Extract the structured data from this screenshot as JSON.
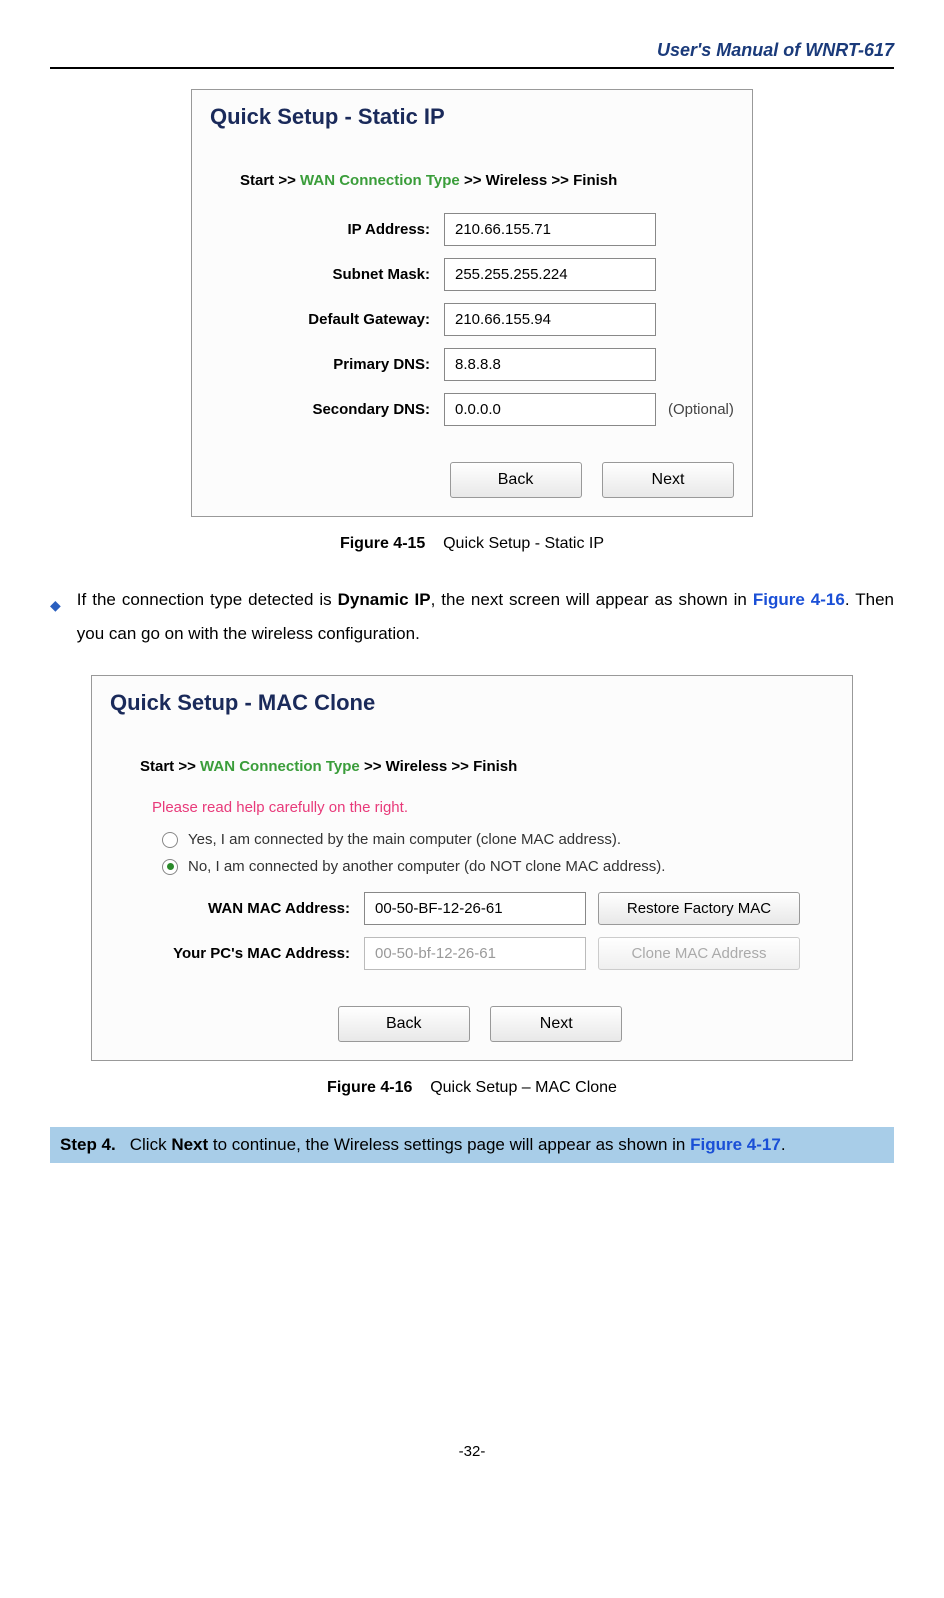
{
  "header": {
    "title": "User's Manual of WNRT-617"
  },
  "figure1": {
    "panelTitle": "Quick Setup - Static IP",
    "breadcrumb": {
      "start": "Start >>",
      "active": "WAN Connection Type",
      "sep1": ">>",
      "wireless": "Wireless",
      "sep2": ">>",
      "finish": "Finish"
    },
    "rows": {
      "ip": {
        "label": "IP Address:",
        "value": "210.66.155.71"
      },
      "subnet": {
        "label": "Subnet Mask:",
        "value": "255.255.255.224"
      },
      "gateway": {
        "label": "Default Gateway:",
        "value": "210.66.155.94"
      },
      "pdns": {
        "label": "Primary DNS:",
        "value": "8.8.8.8"
      },
      "sdns": {
        "label": "Secondary DNS:",
        "value": "0.0.0.0",
        "optional": "(Optional)"
      }
    },
    "buttons": {
      "back": "Back",
      "next": "Next"
    },
    "caption": {
      "label": "Figure 4-15",
      "text": "Quick Setup - Static IP"
    }
  },
  "bulletText": {
    "t1": "If the connection type detected is ",
    "bold1": "Dynamic IP",
    "t2": ", the next screen will appear as shown in ",
    "link1": "Figure 4-16",
    "t3": ". Then you can go on with the wireless configuration."
  },
  "figure2": {
    "panelTitle": "Quick Setup - MAC Clone",
    "breadcrumb": {
      "start": "Start >>",
      "active": "WAN Connection Type",
      "sep1": ">>",
      "wireless": "Wireless",
      "sep2": ">>",
      "finish": "Finish"
    },
    "warning": "Please read help carefully on the right.",
    "radio1": "Yes, I am connected by the main computer (clone MAC address).",
    "radio2": "No, I am connected by another computer (do NOT clone MAC address).",
    "wanRow": {
      "label": "WAN MAC Address:",
      "value": "00-50-BF-12-26-61",
      "btn": "Restore Factory MAC"
    },
    "pcRow": {
      "label": "Your PC's MAC Address:",
      "value": "00-50-bf-12-26-61",
      "btn": "Clone MAC Address"
    },
    "buttons": {
      "back": "Back",
      "next": "Next"
    },
    "caption": {
      "label": "Figure 4-16",
      "text": "Quick Setup – MAC Clone"
    }
  },
  "step4": {
    "label": "Step 4.",
    "t1": "Click ",
    "bold1": "Next",
    "t2": " to continue, the Wireless settings page will appear as shown in ",
    "link1": "Figure 4-17",
    "t3": "."
  },
  "pageNum": "-32-"
}
